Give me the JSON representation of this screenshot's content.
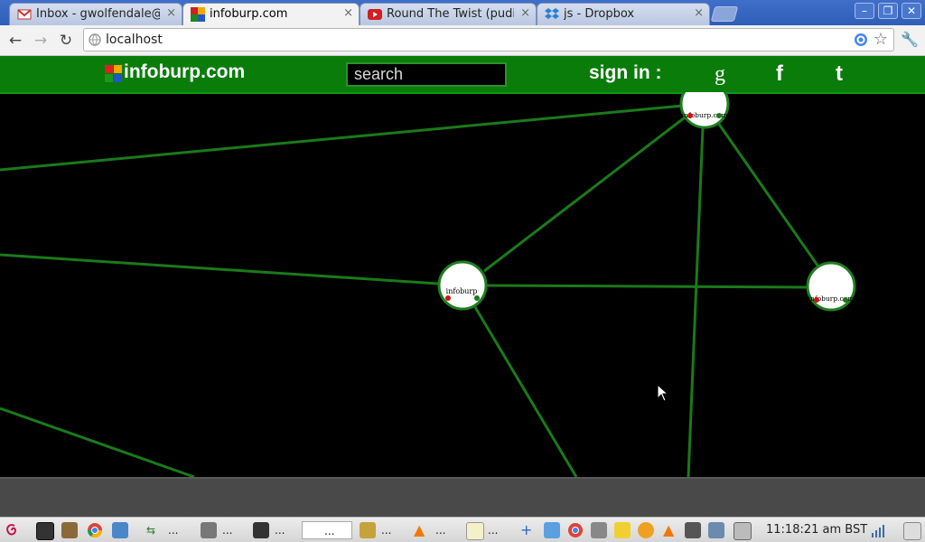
{
  "browser": {
    "tabs": [
      {
        "title": "Inbox - gwolfendale@gr",
        "icon": "gmail-icon",
        "active": false
      },
      {
        "title": "infoburp.com",
        "icon": "infoburp-favicon",
        "active": true
      },
      {
        "title": "Round The Twist (pudilo",
        "icon": "youtube-icon",
        "active": false
      },
      {
        "title": "js - Dropbox",
        "icon": "dropbox-icon",
        "active": false
      }
    ],
    "tab_close_glyph": "×",
    "address": "localhost",
    "window_controls": {
      "minimize": "–",
      "restore": "❐",
      "close": "✕"
    }
  },
  "site": {
    "logo_text": "infoburp.com",
    "search_placeholder": "search",
    "signin_label": "sign in :",
    "social": [
      {
        "name": "google",
        "glyph": "g"
      },
      {
        "name": "facebook",
        "glyph": "f"
      },
      {
        "name": "tumblr",
        "glyph": "t"
      }
    ],
    "colors": {
      "header": "#0a7c0a",
      "edge": "#1a7a1a",
      "node_border": "#1f7f1f",
      "red_dot": "#d11010",
      "green_dot": "#1a7a1a"
    }
  },
  "graph": {
    "nodes": [
      {
        "id": "top",
        "label": "infoburp.com"
      },
      {
        "id": "center",
        "label": "infoburp"
      },
      {
        "id": "right",
        "label": "infoburp.com"
      }
    ]
  },
  "taskbar": {
    "items": [
      "...",
      "...",
      "...",
      "...",
      "...",
      "...",
      "..."
    ],
    "clock": "11:18:21 am BST"
  }
}
